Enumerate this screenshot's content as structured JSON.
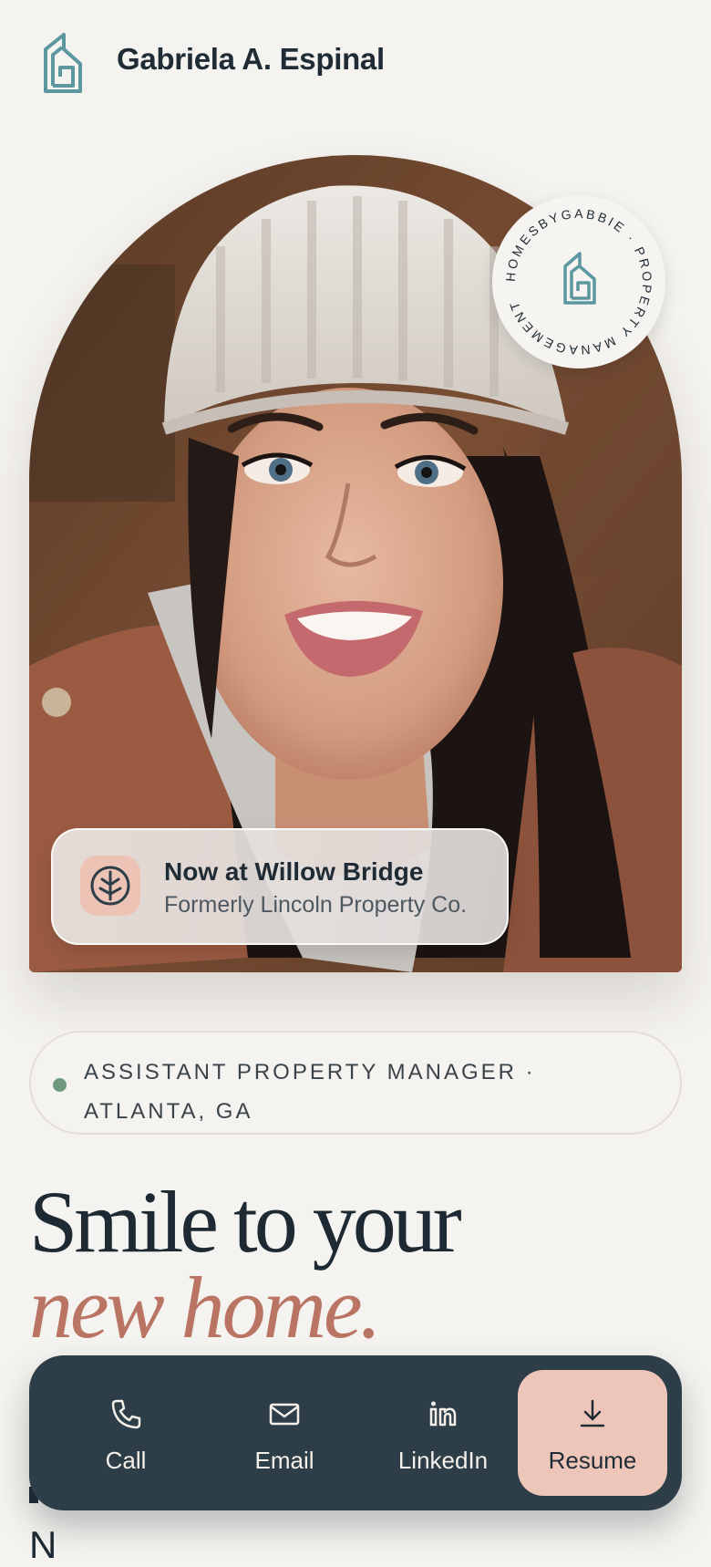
{
  "header": {
    "brand_name": "Gabriela A. Espinal",
    "logo_icon": "house-g-logo-icon"
  },
  "hero": {
    "photo_icon": "portrait-photo",
    "seal_text": "HOMESBYGABBIE · PROPERTY MANAGEMENT"
  },
  "status_card": {
    "title": "Now at Willow Bridge",
    "subtitle": "Formerly Lincoln Property Co.",
    "icon": "willow-tree-icon"
  },
  "role": {
    "text": "ASSISTANT PROPERTY MANAGER · ATLANTA, GA",
    "dot_color": "#6f9a7f"
  },
  "headline": {
    "line1": "Smile to your",
    "line2": "new home."
  },
  "below_fold": {
    "partial_text": "N"
  },
  "actions": [
    {
      "label": "Call",
      "icon": "phone-icon"
    },
    {
      "label": "Email",
      "icon": "mail-icon"
    },
    {
      "label": "LinkedIn",
      "icon": "linkedin-icon"
    },
    {
      "label": "Resume",
      "icon": "download-icon"
    }
  ],
  "colors": {
    "background": "#f5f3ef",
    "accent_teal": "#5c97a0",
    "accent_rose": "#b97464",
    "action_bar": "#2e3e48",
    "resume_button": "#eec6b9"
  }
}
